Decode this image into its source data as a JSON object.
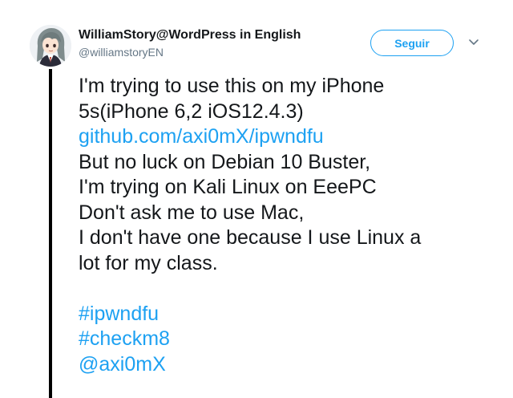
{
  "author": {
    "name": "WilliamStory@WordPress in English",
    "handle": "@williamstoryEN"
  },
  "follow_label": "Seguir",
  "tweet": {
    "lines": [
      "I'm trying to use this on my iPhone",
      "5s(iPhone 6,2 iOS12.4.3)"
    ],
    "link": "github.com/axi0mX/ipwndfu",
    "lines_after_link": [
      "But no luck on Debian 10 Buster,",
      "I'm trying on Kali Linux on EeePC",
      "Don't ask me to use Mac,",
      "I don't have one because I use Linux a",
      "lot for my class."
    ],
    "hashtags": [
      "#ipwndfu",
      "#checkm8"
    ],
    "mention": "@axi0mX"
  },
  "colors": {
    "link": "#1da1f2",
    "text": "#14171a",
    "secondary": "#657786",
    "thread_line": "#000000"
  },
  "icons": {
    "caret": "chevron-down-icon",
    "avatar": "anime-avatar"
  }
}
